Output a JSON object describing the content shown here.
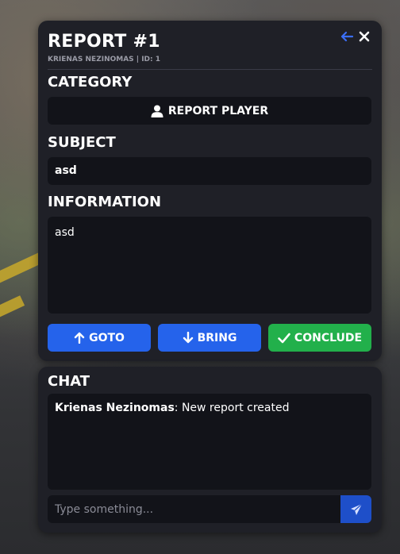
{
  "report": {
    "title": "REPORT #1",
    "subtitle": "KRIENAS NEZINOMAS | ID: 1",
    "category_label": "CATEGORY",
    "category_value": "REPORT PLAYER",
    "subject_label": "SUBJECT",
    "subject_value": "asd",
    "information_label": "INFORMATION",
    "information_value": "asd",
    "buttons": {
      "goto": "GOTO",
      "bring": "BRING",
      "conclude": "CONCLUDE"
    }
  },
  "chat": {
    "label": "CHAT",
    "messages": [
      {
        "author": "Krienas Nezinomas",
        "text": ": New report created"
      }
    ],
    "input_placeholder": "Type something..."
  },
  "colors": {
    "panel_bg": "#1f2027",
    "field_bg": "#121319",
    "accent_blue": "#2563eb",
    "accent_green": "#22b04b",
    "send_blue": "#1e4fc9"
  },
  "icons": {
    "back": "arrow-left-icon",
    "close": "close-icon",
    "category": "user-icon",
    "goto": "arrow-up-icon",
    "bring": "arrow-down-icon",
    "conclude": "check-icon",
    "send": "paper-plane-icon"
  }
}
